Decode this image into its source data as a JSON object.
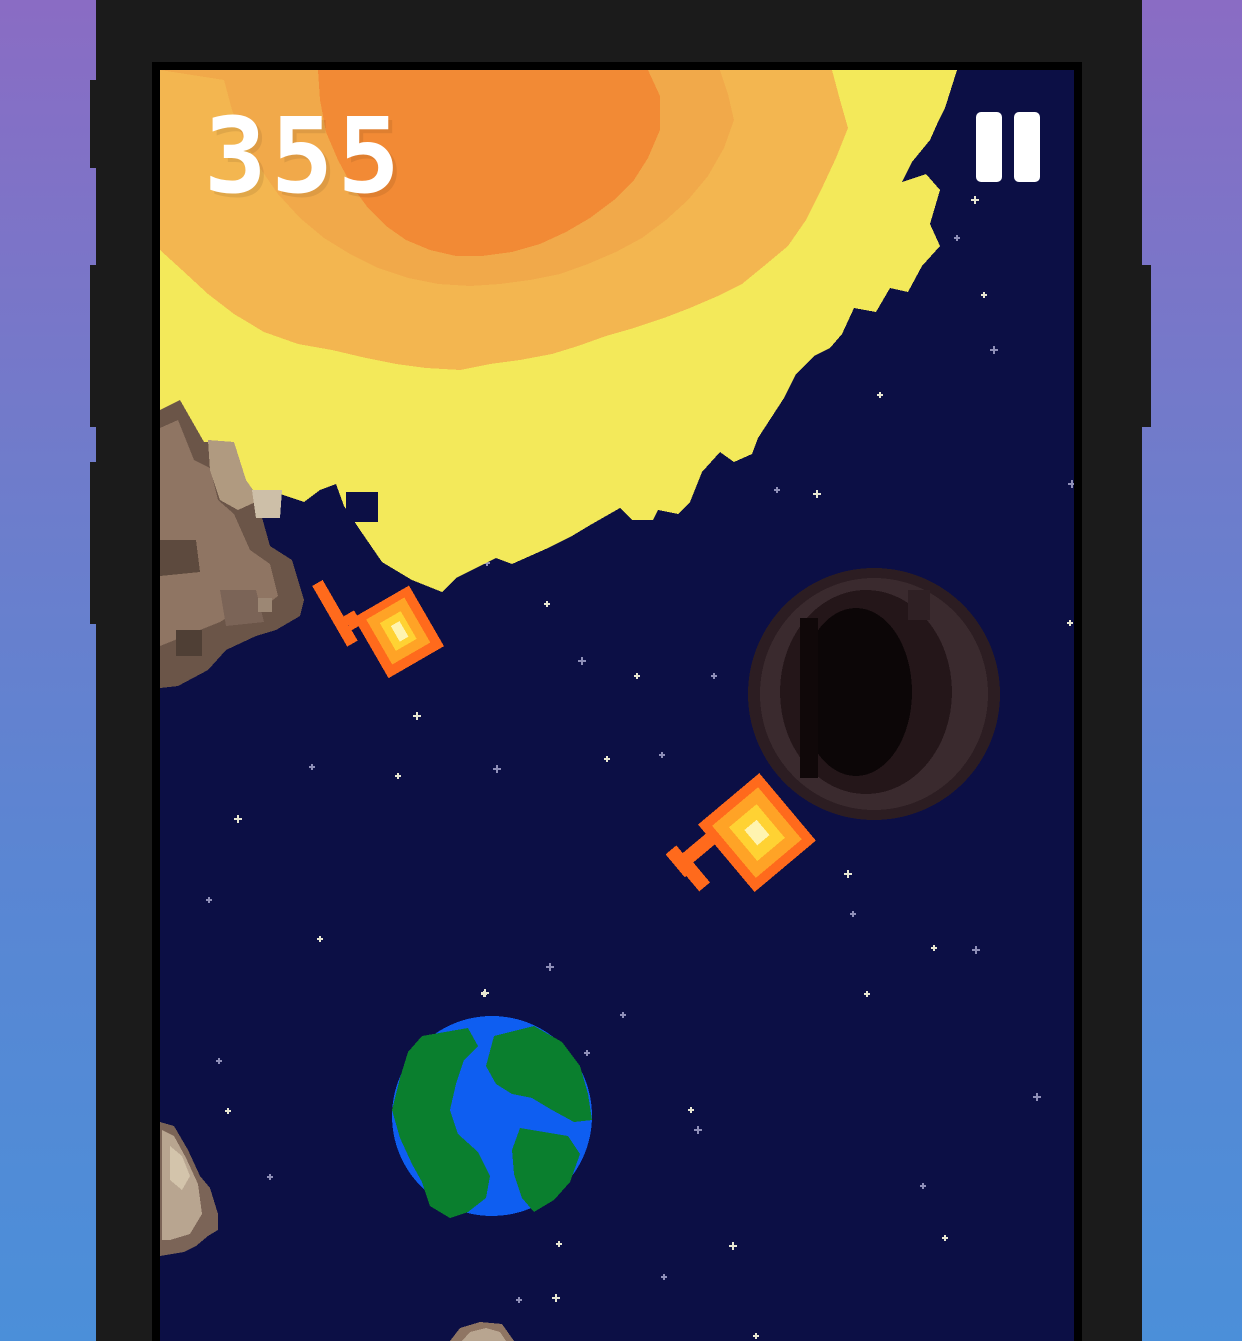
{
  "game": {
    "score": "355",
    "pause_icon": "pause-icon"
  },
  "colors": {
    "background_outer_top": "#8a6cc4",
    "background_outer_bottom": "#4b8fd9",
    "phone_frame": "#1b1b1b",
    "space": "#0c0f45",
    "sun_core": "#f28a35",
    "sun_mid": "#f3b650",
    "sun_outer": "#f3e95a",
    "earth_ocean": "#0e5ef1",
    "earth_land": "#0a7f2e",
    "black_hole": "#2a1c21",
    "fireball": "#ff6a1c",
    "asteroid": "#6b5548"
  },
  "objects": [
    {
      "name": "sun",
      "icon": "sun-icon"
    },
    {
      "name": "earth",
      "icon": "earth-icon"
    },
    {
      "name": "black-hole",
      "icon": "black-hole-icon"
    },
    {
      "name": "fireball",
      "icon": "fireball-icon"
    },
    {
      "name": "fireball",
      "icon": "fireball-icon"
    },
    {
      "name": "asteroid",
      "icon": "asteroid-icon"
    }
  ]
}
